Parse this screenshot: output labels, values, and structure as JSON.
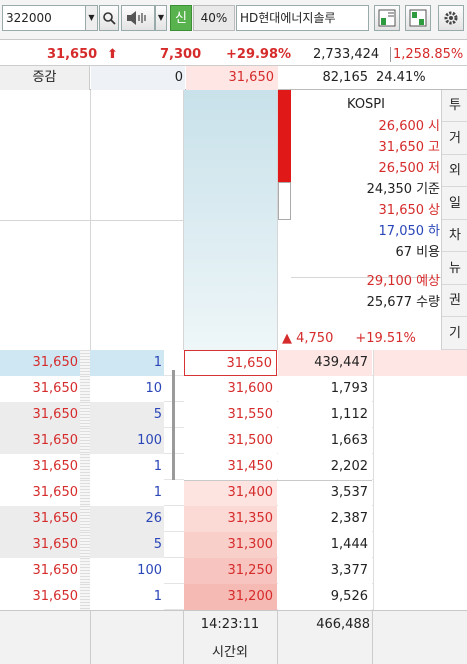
{
  "toolbar": {
    "code": "322000",
    "sin_label": "신",
    "percent": "40%",
    "stock_name": "HD현대에너지솔루"
  },
  "summary": {
    "price": "31,650",
    "arrow": "⬆",
    "change": "7,300",
    "change_pct": "+29.98%",
    "volume": "2,733,424",
    "volume_ratio": "1,258.85%"
  },
  "row2": {
    "label": "증감",
    "value": "0",
    "price": "31,650",
    "vol": "82,165",
    "pct": "24.41%"
  },
  "info": {
    "market": "KOSPI",
    "rows": [
      {
        "value": "26,600",
        "label": "시",
        "color": "red"
      },
      {
        "value": "31,650",
        "label": "고",
        "color": "red"
      },
      {
        "value": "26,500",
        "label": "저",
        "color": "red"
      },
      {
        "value": "24,350",
        "label": "기준",
        "color": "dark"
      },
      {
        "value": "31,650",
        "label": "상",
        "color": "red"
      },
      {
        "value": "17,050",
        "label": "하",
        "color": "blue"
      },
      {
        "value": "67",
        "label": "비용",
        "color": "dark"
      },
      {
        "value": "29,100",
        "label": "예상",
        "color": "red"
      },
      {
        "value": "25,677",
        "label": "수량",
        "color": "dark"
      }
    ],
    "exp_change": "▲ 4,750",
    "exp_pct": "+19.51%"
  },
  "side_tabs": [
    "투",
    "거",
    "외",
    "일",
    "차",
    "뉴",
    "권",
    "기"
  ],
  "orderbook": [
    {
      "trade_price": "31,650",
      "trade_qty": "1",
      "price": "31,650",
      "bid": "439,447"
    },
    {
      "trade_price": "31,650",
      "trade_qty": "10",
      "price": "31,600",
      "bid": "1,793"
    },
    {
      "trade_price": "31,650",
      "trade_qty": "5",
      "price": "31,550",
      "bid": "1,112"
    },
    {
      "trade_price": "31,650",
      "trade_qty": "100",
      "price": "31,500",
      "bid": "1,663"
    },
    {
      "trade_price": "31,650",
      "trade_qty": "1",
      "price": "31,450",
      "bid": "2,202"
    },
    {
      "trade_price": "31,650",
      "trade_qty": "1",
      "price": "31,400",
      "bid": "3,537"
    },
    {
      "trade_price": "31,650",
      "trade_qty": "26",
      "price": "31,350",
      "bid": "2,387"
    },
    {
      "trade_price": "31,650",
      "trade_qty": "5",
      "price": "31,300",
      "bid": "1,444"
    },
    {
      "trade_price": "31,650",
      "trade_qty": "100",
      "price": "31,250",
      "bid": "3,377"
    },
    {
      "trade_price": "31,650",
      "trade_qty": "1",
      "price": "31,200",
      "bid": "9,526"
    }
  ],
  "footer": {
    "time": "14:23:11",
    "session": "시간외",
    "total_bid": "466,488"
  }
}
